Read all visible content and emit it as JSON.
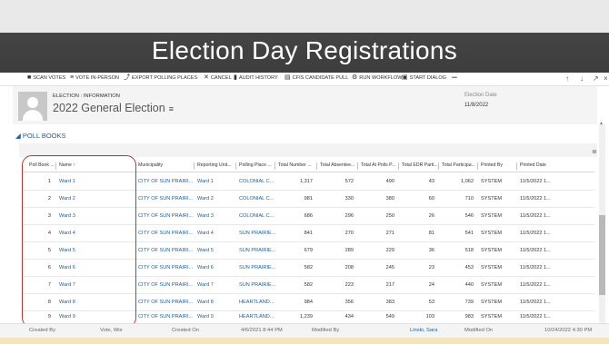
{
  "banner": {
    "title": "Election Day Registrations"
  },
  "toolbar": {
    "items": [
      {
        "label": "SCAN VOTES",
        "icon": "scan-icon"
      },
      {
        "label": "VOTE IN-PERSON",
        "icon": "list-icon"
      },
      {
        "label": "EXPORT POLLING PLACES",
        "icon": "export-icon"
      },
      {
        "label": "CANCEL",
        "icon": "close-icon"
      },
      {
        "label": "AUDIT HISTORY",
        "icon": "bar-chart-icon"
      },
      {
        "label": "CFIS CANDIDATE PULL",
        "icon": "cart-icon"
      },
      {
        "label": "RUN WORKFLOW",
        "icon": "workflow-icon"
      },
      {
        "label": "START DIALOG",
        "icon": "dialog-icon"
      }
    ],
    "more": "•••",
    "right_icons": [
      "↑",
      "↓",
      "↗",
      "×"
    ]
  },
  "header": {
    "label": "ELECTION : INFORMATION",
    "title": "2022 General Election",
    "title_menu_icon": "≡",
    "date_label": "Election Date",
    "date_value": "11/8/2022"
  },
  "section": {
    "title": "◢ POLL BOOKS"
  },
  "grid": {
    "icon": "≣",
    "columns": [
      "Poll Book ...",
      "Name ↑",
      "Municipality",
      "Reporting Unit...",
      "Polling Place ...",
      "Total Number ...",
      "Total Absentee...",
      "Total At Polls P...",
      "Total EDR Parti...",
      "Total Participa...",
      "Printed By",
      "Printed Date"
    ],
    "rows": [
      {
        "num": "1",
        "name": "Ward 1",
        "muni": "CITY OF SUN PRAIRI...",
        "unit": "Ward 1",
        "place": "COLONIAL C...",
        "total": "1,317",
        "absentee": "572",
        "at_polls": "490",
        "edr": "43",
        "participation": "1,062",
        "printed_by": "SYSTEM",
        "printed_date": "11/5/2022 1..."
      },
      {
        "num": "2",
        "name": "Ward 2",
        "muni": "CITY OF SUN PRAIRI...",
        "unit": "Ward 2",
        "place": "COLONIAL C...",
        "total": "981",
        "absentee": "330",
        "at_polls": "380",
        "edr": "60",
        "participation": "710",
        "printed_by": "SYSTEM",
        "printed_date": "11/5/2022 1..."
      },
      {
        "num": "3",
        "name": "Ward 3",
        "muni": "CITY OF SUN PRAIRI...",
        "unit": "Ward 3",
        "place": "COLONIAL C...",
        "total": "686",
        "absentee": "296",
        "at_polls": "250",
        "edr": "26",
        "participation": "546",
        "printed_by": "SYSTEM",
        "printed_date": "11/5/2022 1..."
      },
      {
        "num": "4",
        "name": "Ward 4",
        "muni": "CITY OF SUN PRAIRI...",
        "unit": "Ward 4",
        "place": "SUN PRAIRIE...",
        "total": "841",
        "absentee": "270",
        "at_polls": "271",
        "edr": "81",
        "participation": "541",
        "printed_by": "SYSTEM",
        "printed_date": "11/5/2022 1..."
      },
      {
        "num": "5",
        "name": "Ward 5",
        "muni": "CITY OF SUN PRAIRI...",
        "unit": "Ward 5",
        "place": "SUN PRAIRIE...",
        "total": "679",
        "absentee": "289",
        "at_polls": "229",
        "edr": "36",
        "participation": "518",
        "printed_by": "SYSTEM",
        "printed_date": "11/5/2022 1..."
      },
      {
        "num": "6",
        "name": "Ward 6",
        "muni": "CITY OF SUN PRAIRI...",
        "unit": "Ward 6",
        "place": "SUN PRAIRIE...",
        "total": "582",
        "absentee": "208",
        "at_polls": "245",
        "edr": "23",
        "participation": "453",
        "printed_by": "SYSTEM",
        "printed_date": "11/5/2022 1..."
      },
      {
        "num": "7",
        "name": "Ward 7",
        "muni": "CITY OF SUN PRAIRI...",
        "unit": "Ward 7",
        "place": "SUN PRAIRIE...",
        "total": "582",
        "absentee": "223",
        "at_polls": "217",
        "edr": "24",
        "participation": "440",
        "printed_by": "SYSTEM",
        "printed_date": "11/5/2022 1..."
      },
      {
        "num": "8",
        "name": "Ward 8",
        "muni": "CITY OF SUN PRAIRI...",
        "unit": "Ward 8",
        "place": "HEARTLAND...",
        "total": "984",
        "absentee": "356",
        "at_polls": "383",
        "edr": "53",
        "participation": "739",
        "printed_by": "SYSTEM",
        "printed_date": "11/5/2022 1..."
      },
      {
        "num": "9",
        "name": "Ward 9",
        "muni": "CITY OF SUN PRAIRI...",
        "unit": "Ward 9",
        "place": "HEARTLAND...",
        "total": "1,239",
        "absentee": "434",
        "at_polls": "549",
        "edr": "103",
        "participation": "983",
        "printed_by": "SYSTEM",
        "printed_date": "11/5/2022 1..."
      }
    ]
  },
  "footer": {
    "created_by_label": "Created By",
    "created_by_value": "Vote, Wis",
    "created_on_label": "Created On",
    "created_on_value": "4/6/2021 8:44 PM",
    "modified_by_label": "Modified By",
    "modified_by_value": "Linski, Sara",
    "modified_on_label": "Modified On",
    "modified_on_value": "10/24/2022 4:30 PM"
  },
  "colors": {
    "link": "#1a5fa8",
    "highlight": "#b33a36",
    "banner": "#444444"
  }
}
